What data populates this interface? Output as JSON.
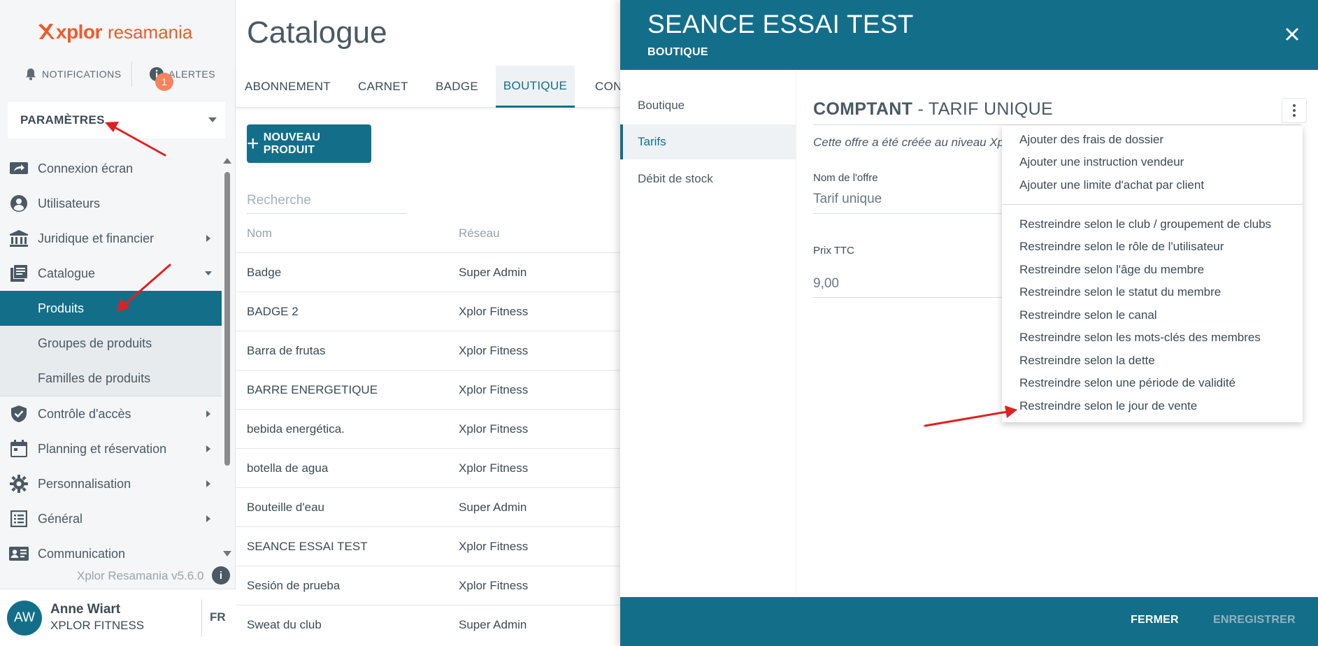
{
  "sidebar": {
    "logo": {
      "word1": "xplor",
      "word2": "resamania"
    },
    "notifications_label": "NOTIFICATIONS",
    "alerts_label": "ALERTES",
    "alerts_count": "1",
    "params_label": "PARAMÈTRES",
    "nav": [
      {
        "label": "Connexion écran",
        "icon": "screen-connect-icon"
      },
      {
        "label": "Utilisateurs",
        "icon": "user-circle-icon"
      },
      {
        "label": "Juridique et financier",
        "icon": "bank-icon"
      },
      {
        "label": "Catalogue",
        "icon": "catalog-icon"
      },
      {
        "label": "Contrôle d'accès",
        "icon": "shield-check-icon"
      },
      {
        "label": "Planning et réservation",
        "icon": "calendar-icon"
      },
      {
        "label": "Personnalisation",
        "icon": "gear-icon"
      },
      {
        "label": "Général",
        "icon": "list-icon"
      },
      {
        "label": "Communication",
        "icon": "contact-card-icon"
      }
    ],
    "catalogue_sub": [
      "Produits",
      "Groupes de produits",
      "Familles de produits"
    ],
    "version": "Xplor Resamania v5.6.0",
    "user": {
      "initials": "AW",
      "name": "Anne Wiart",
      "org": "XPLOR FITNESS",
      "lang": "FR"
    }
  },
  "main": {
    "title": "Catalogue",
    "tabs": [
      "ABONNEMENT",
      "CARNET",
      "BADGE",
      "BOUTIQUE",
      "CON"
    ],
    "new_button": "NOUVEAU PRODUIT",
    "search_placeholder": "Recherche",
    "columns": [
      "Nom",
      "Réseau"
    ],
    "rows": [
      [
        "Badge",
        "Super Admin"
      ],
      [
        "BADGE 2",
        "Xplor Fitness"
      ],
      [
        "Barra de frutas",
        "Xplor Fitness"
      ],
      [
        "BARRE ENERGETIQUE",
        "Xplor Fitness"
      ],
      [
        "bebida energética.",
        "Xplor Fitness"
      ],
      [
        "botella de agua",
        "Xplor Fitness"
      ],
      [
        "Bouteille d'eau",
        "Super Admin"
      ],
      [
        "SEANCE ESSAI TEST",
        "Xplor Fitness"
      ],
      [
        "Sesión de prueba",
        "Xplor Fitness"
      ],
      [
        "Sweat du club",
        "Super Admin"
      ]
    ]
  },
  "drawer": {
    "title": "SEANCE ESSAI TEST",
    "subtitle": "BOUTIQUE",
    "nav": [
      "Boutique",
      "Tarifs",
      "Débit de stock"
    ],
    "offer": {
      "title_bold": "COMPTANT",
      "title_rest": " - TARIF UNIQUE",
      "note": "Cette offre a été créée au niveau Xp",
      "name_label": "Nom de l'offre",
      "name_value": "Tarif unique",
      "price_label": "Prix TTC",
      "price_value": "9,00"
    },
    "footer": {
      "close": "FERMER",
      "save": "ENREGISTRER"
    },
    "menu": {
      "group1": [
        "Ajouter des frais de dossier",
        "Ajouter une instruction vendeur",
        "Ajouter une limite d'achat par client"
      ],
      "group2": [
        "Restreindre selon le club / groupement de clubs",
        "Restreindre selon le rôle de l'utilisateur",
        "Restreindre selon l'âge du membre",
        "Restreindre selon le statut du membre",
        "Restreindre selon le canal",
        "Restreindre selon les mots-clés des membres",
        "Restreindre selon la dette",
        "Restreindre selon une période de validité",
        "Restreindre selon le jour de vente"
      ]
    }
  },
  "colors": {
    "primary": "#136f89",
    "brand_orange": "#f15a2b",
    "badge": "#f4845f",
    "annotation_red": "#e02020"
  }
}
